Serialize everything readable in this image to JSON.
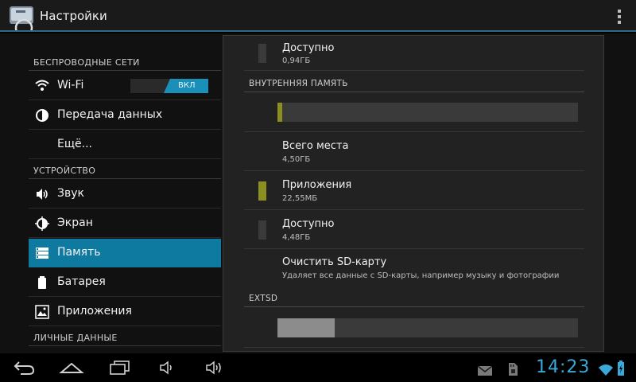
{
  "app": {
    "title": "Настройки",
    "accent_color": "#0f7aa0"
  },
  "sidebar": {
    "sections": [
      {
        "header": "БЕСПРОВОДНЫЕ СЕТИ"
      },
      {
        "header": "УСТРОЙСТВО"
      },
      {
        "header": "ЛИЧНЫЕ ДАННЫЕ"
      }
    ],
    "items": [
      {
        "label": "Wi-Fi",
        "icon": "wifi-icon"
      },
      {
        "label": "Передача данных",
        "icon": "data-usage-icon"
      },
      {
        "label": "Ещё...",
        "icon": ""
      },
      {
        "label": "Звук",
        "icon": "speaker-icon"
      },
      {
        "label": "Экран",
        "icon": "brightness-icon"
      },
      {
        "label": "Память",
        "icon": "storage-icon",
        "active": true
      },
      {
        "label": "Батарея",
        "icon": "battery-icon"
      },
      {
        "label": "Приложения",
        "icon": "apps-icon"
      }
    ],
    "wifi_toggle": {
      "label": "ВКЛ",
      "state": "on"
    }
  },
  "storage": {
    "top_available": {
      "title": "Доступно",
      "value": "0,94ГБ"
    },
    "internal": {
      "header": "ВНУТРЕННЯЯ ПАМЯТЬ",
      "usage_fraction": 0.016,
      "total": {
        "title": "Всего места",
        "value": "4,50ГБ"
      },
      "apps": {
        "title": "Приложения",
        "value": "22,55МБ",
        "color": "#8a8f1f"
      },
      "available": {
        "title": "Доступно",
        "value": "4,48ГБ"
      },
      "clear_sd": {
        "title": "Очистить SD-карту",
        "subtitle": "Удаляет все данные с SD-карты, например музыку и фотографии"
      }
    },
    "extsd": {
      "header": "EXTSD",
      "usage_fraction": 0.19,
      "color": "#8c8c8c"
    }
  },
  "status": {
    "time": "14:23"
  }
}
